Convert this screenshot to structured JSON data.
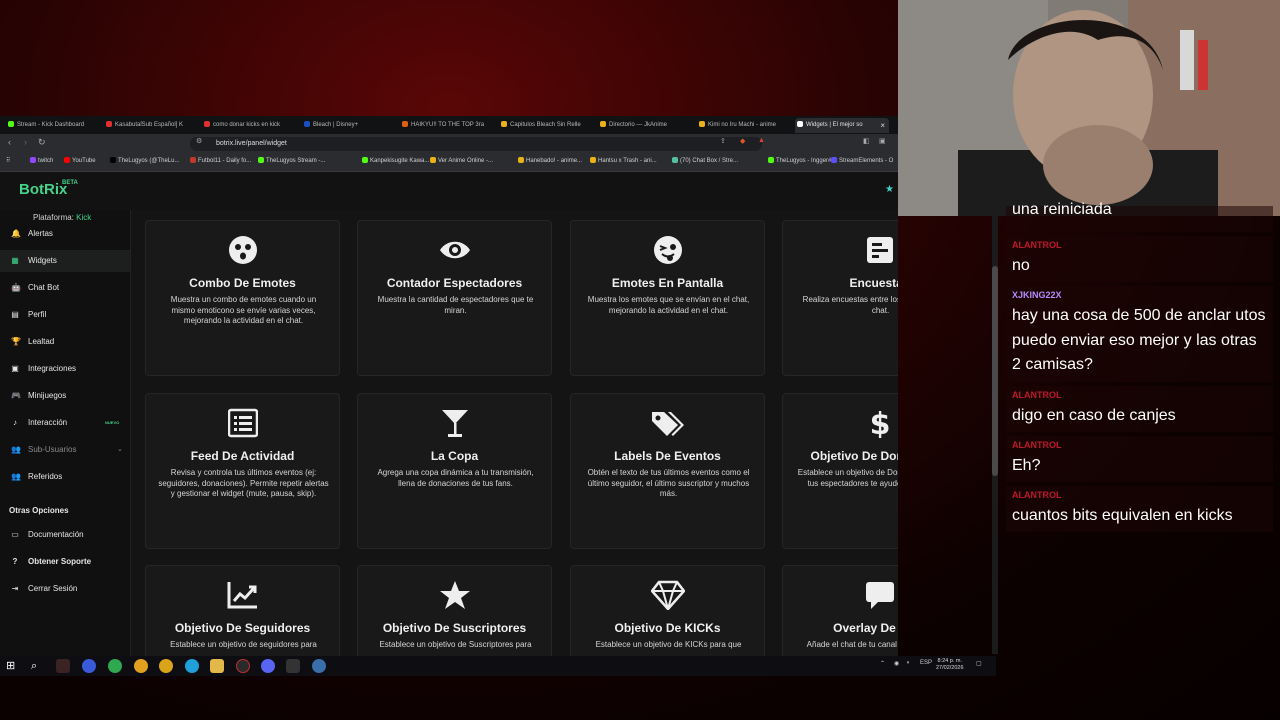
{
  "browser": {
    "tabs": [
      {
        "label": "Stream - Kick Dashboard",
        "color": "#53fc18"
      },
      {
        "label": "KasabutaſSub Español] K",
        "color": "#e03030"
      },
      {
        "label": "como donar kicks en kick",
        "color": "#e03030"
      },
      {
        "label": "Bleach | Disney+",
        "color": "#1a4fbf"
      },
      {
        "label": "HAIKYU!! TO THE TOP 3ra",
        "color": "#e35d10"
      },
      {
        "label": "Capitulos Bleach Sin Relle",
        "color": "#e8b21a"
      },
      {
        "label": "Directorio — JkAnime",
        "color": "#e8b21a"
      },
      {
        "label": "Kimi no Iru Machi - anime",
        "color": "#e8b21a"
      },
      {
        "label": "Widgets | El mejor so",
        "color": "#ffffff"
      }
    ],
    "url": "botrix.live/panel/widget",
    "bookmarks": [
      {
        "label": "twitch",
        "color": "#9146ff"
      },
      {
        "label": "YouTube",
        "color": "#ff0000"
      },
      {
        "label": "TheLugyos (@TheLu...",
        "color": "#000000"
      },
      {
        "label": "Futbol11 - Daily fo...",
        "color": "#c0392b"
      },
      {
        "label": "TheLugyos Stream -...",
        "color": "#53fc18"
      },
      {
        "label": "Kanpekisugite Kawa...",
        "color": "#53fc18"
      },
      {
        "label": "Ver Anime Online -...",
        "color": "#e8b21a"
      },
      {
        "label": "Hanebado! - anime...",
        "color": "#e8b21a"
      },
      {
        "label": "Hantsu x Trash - ani...",
        "color": "#e8b21a"
      },
      {
        "label": "(70) Chat Box / Stre...",
        "color": "#53c0a0"
      },
      {
        "label": "TheLugyos - Ingger#...",
        "color": "#53fc18"
      },
      {
        "label": "StreamElements - O",
        "color": "#5a4fff"
      }
    ]
  },
  "app": {
    "logo": "BotRix",
    "beta": "BETA",
    "platform_label": "Plataforma:",
    "platform_value": "Kick"
  },
  "sidebar": {
    "items": [
      {
        "label": "Alertas",
        "icon": "bell-icon",
        "glyph": "🔔"
      },
      {
        "label": "Widgets",
        "icon": "widgets-icon",
        "glyph": "▦"
      },
      {
        "label": "Chat Bot",
        "icon": "robot-icon",
        "glyph": "🤖"
      },
      {
        "label": "Perfil",
        "icon": "id-card-icon",
        "glyph": "▤"
      },
      {
        "label": "Lealtad",
        "icon": "trophy-icon",
        "glyph": "🏆"
      },
      {
        "label": "Integraciones",
        "icon": "puzzle-icon",
        "glyph": "▣"
      },
      {
        "label": "Minijuegos",
        "icon": "gamepad-icon",
        "glyph": "🎮"
      },
      {
        "label": "Interacción",
        "icon": "music-icon",
        "glyph": "♪"
      },
      {
        "label": "Sub-Usuarios",
        "icon": "users-icon",
        "glyph": "👥"
      },
      {
        "label": "Referidos",
        "icon": "user-group-icon",
        "glyph": "👥"
      }
    ],
    "nuevo_badge": "NUEVO",
    "other_title": "Otras Opciones",
    "other_items": [
      {
        "label": "Documentación",
        "icon": "book-icon",
        "glyph": "▭"
      },
      {
        "label": "Obtener Soporte",
        "icon": "question-icon",
        "glyph": "?"
      },
      {
        "label": "Cerrar Sesión",
        "icon": "logout-icon",
        "glyph": "⇥"
      }
    ]
  },
  "widgets": [
    {
      "title": "Combo De Emotes",
      "desc": "Muestra un combo de emotes cuando un mismo emoticono se envíe varias veces, mejorando la actividad en el chat.",
      "icon": "surprised-face-icon"
    },
    {
      "title": "Contador Espectadores",
      "desc": "Muestra la cantidad de espectadores que te miran.",
      "icon": "eye-icon"
    },
    {
      "title": "Emotes En Pantalla",
      "desc": "Muestra los emotes que se envían en el chat, mejorando la actividad en el chat.",
      "icon": "wink-tongue-icon"
    },
    {
      "title": "Encuestas",
      "desc": "Realiza encuestas entre los miembros de tu chat.",
      "icon": "poll-icon"
    },
    {
      "title": "Feed De Actividad",
      "desc": "Revisa y controla tus últimos eventos (ej: seguidores, donaciones). Permite repetir alertas y gestionar el widget (mute, pausa, skip).",
      "icon": "list-icon"
    },
    {
      "title": "La Copa",
      "desc": "Agrega una copa dinámica a tu transmisión, llena de donaciones de tus fans.",
      "icon": "cocktail-icon"
    },
    {
      "title": "Labels De Eventos",
      "desc": "Obtén el texto de tus últimos eventos como el último seguidor, el último suscriptor y muchos más.",
      "icon": "tags-icon"
    },
    {
      "title": "Objetivo De Donaciones",
      "desc": "Establece un objetivo de Donaciones para que tus espectadores te ayuden a alcanzarlo.",
      "icon": "dollar-icon"
    },
    {
      "title": "Objetivo De Seguidores",
      "desc": "Establece un objetivo de seguidores para",
      "icon": "chart-line-icon"
    },
    {
      "title": "Objetivo De Suscriptores",
      "desc": "Establece un objetivo de Suscriptores para",
      "icon": "star-icon"
    },
    {
      "title": "Objetivo De KICKs",
      "desc": "Establece un objetivo de KICKs para que",
      "icon": "gem-icon"
    },
    {
      "title": "Overlay De Chat",
      "desc": "Añade el chat de tu canal a tu ventana de",
      "icon": "chat-bubble-icon"
    }
  ],
  "taskbar": {
    "lang": "ESP",
    "time": "8:24 p. m.",
    "date": "27/02/2026"
  },
  "chat": {
    "messages": [
      {
        "user": "",
        "text": "una reiniciada",
        "user_color": "#ff5a5a"
      },
      {
        "user": "ALANTROL",
        "text": "no",
        "user_color": "#c0182a"
      },
      {
        "user": "XJKING22X",
        "text": "hay una cosa de 500 de anclar utos puedo enviar eso mejor y las otras 2 camisas?",
        "user_color": "#b589ff"
      },
      {
        "user": "ALANTROL",
        "text": "digo en caso de canjes",
        "user_color": "#c0182a"
      },
      {
        "user": "ALANTROL",
        "text": "Eh?",
        "user_color": "#c0182a"
      },
      {
        "user": "ALANTROL",
        "text": "cuantos bits equivalen en kicks",
        "user_color": "#c0182a"
      }
    ]
  }
}
